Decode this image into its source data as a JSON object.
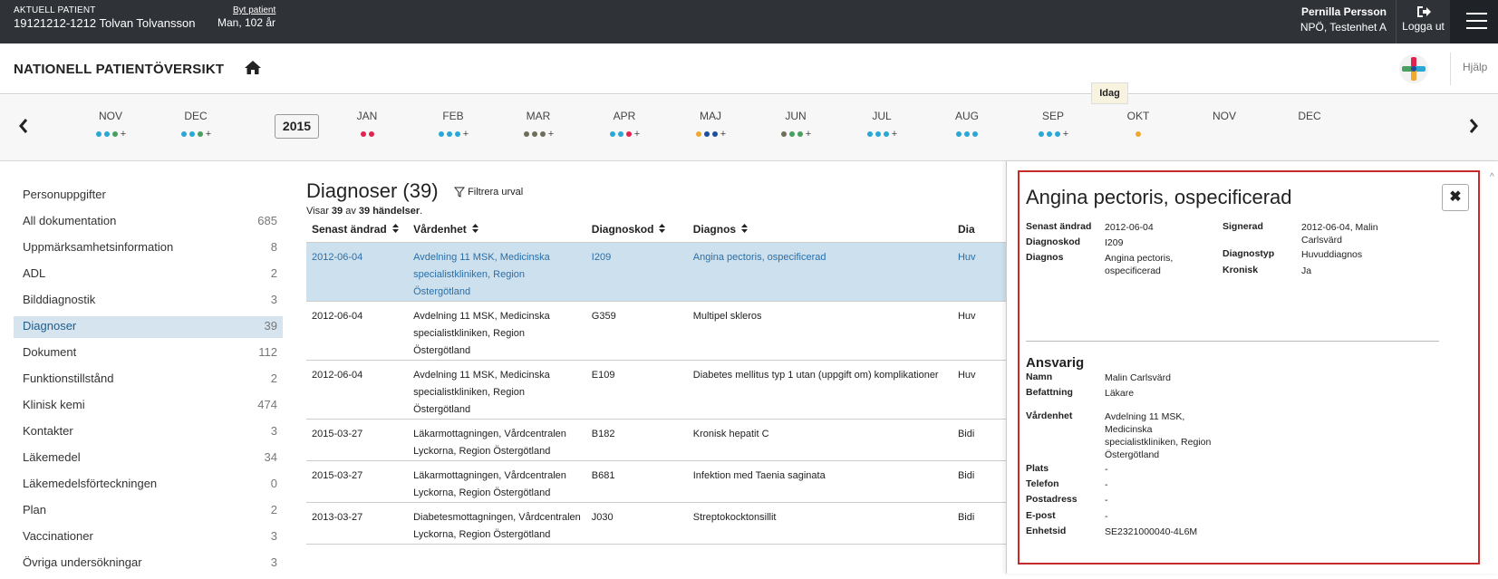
{
  "patient": {
    "label": "AKTUELL PATIENT",
    "id_name": "19121212-1212 Tolvan Tolvansson",
    "change_link": "Byt patient",
    "sex_age": "Man, 102 år"
  },
  "user": {
    "name": "Pernilla Persson",
    "unit": "NPÖ, Testenhet A",
    "logout": "Logga ut"
  },
  "header": {
    "title": "NATIONELL PATIENTÖVERSIKT",
    "help": "Hjälp"
  },
  "timeline": {
    "year": "2015",
    "today": "Idag",
    "months": [
      {
        "label": "NOV",
        "dots": [
          "#29a8d6",
          "#29a8d6",
          "#4a9f5e"
        ],
        "plus": "+"
      },
      {
        "label": "DEC",
        "dots": [
          "#29a8d6",
          "#29a8d6",
          "#4a9f5e"
        ],
        "plus": "+"
      },
      {
        "label": "JAN",
        "dots": [
          "#e0234f",
          "#e0234f"
        ],
        "plus": ""
      },
      {
        "label": "FEB",
        "dots": [
          "#29a8d6",
          "#29a8d6",
          "#29a8d6"
        ],
        "plus": "+"
      },
      {
        "label": "MAR",
        "dots": [
          "#6e6e5a",
          "#6e6e5a",
          "#6e6e5a"
        ],
        "plus": "+"
      },
      {
        "label": "APR",
        "dots": [
          "#29a8d6",
          "#29a8d6",
          "#e0234f"
        ],
        "plus": "+"
      },
      {
        "label": "MAJ",
        "dots": [
          "#f0a830",
          "#1d4f9e",
          "#1d4f9e"
        ],
        "plus": "+"
      },
      {
        "label": "JUN",
        "dots": [
          "#6e6e5a",
          "#4a9f5e",
          "#4a9f5e"
        ],
        "plus": "+"
      },
      {
        "label": "JUL",
        "dots": [
          "#29a8d6",
          "#29a8d6",
          "#29a8d6"
        ],
        "plus": "+"
      },
      {
        "label": "AUG",
        "dots": [
          "#29a8d6",
          "#29a8d6",
          "#29a8d6"
        ],
        "plus": ""
      },
      {
        "label": "SEP",
        "dots": [
          "#29a8d6",
          "#29a8d6",
          "#29a8d6"
        ],
        "plus": "+"
      },
      {
        "label": "OKT",
        "dots": [
          "#f0a830"
        ],
        "plus": ""
      },
      {
        "label": "NOV",
        "dots": [],
        "plus": ""
      },
      {
        "label": "DEC",
        "dots": [],
        "plus": ""
      }
    ]
  },
  "sidebar": {
    "items": [
      {
        "label": "Personuppgifter",
        "count": ""
      },
      {
        "label": "All dokumentation",
        "count": "685"
      },
      {
        "label": "Uppmärksamhetsinformation",
        "count": "8"
      },
      {
        "label": "ADL",
        "count": "2"
      },
      {
        "label": "Bilddiagnostik",
        "count": "3"
      },
      {
        "label": "Diagnoser",
        "count": "39",
        "active": true
      },
      {
        "label": "Dokument",
        "count": "112"
      },
      {
        "label": "Funktionstillstånd",
        "count": "2"
      },
      {
        "label": "Klinisk kemi",
        "count": "474"
      },
      {
        "label": "Kontakter",
        "count": "3"
      },
      {
        "label": "Läkemedel",
        "count": "34"
      },
      {
        "label": "Läkemedelsförteckningen",
        "count": "0"
      },
      {
        "label": "Plan",
        "count": "2"
      },
      {
        "label": "Vaccinationer",
        "count": "3"
      },
      {
        "label": "Övriga undersökningar",
        "count": "3"
      }
    ]
  },
  "main": {
    "title": "Diagnoser (39)",
    "filter": "Filtrera urval",
    "shows_prefix": "Visar ",
    "shows_a": "39",
    "shows_mid": " av ",
    "shows_b": "39 händelser",
    "shows_suffix": ".",
    "columns": [
      "Senast ändrad",
      "Vårdenhet",
      "Diagnoskod",
      "Diagnos",
      "Dia"
    ],
    "rows": [
      {
        "date": "2012-06-04",
        "unit": [
          "Avdelning 11 MSK, Medicinska",
          "specialistkliniken, Region",
          "Östergötland"
        ],
        "code": "I209",
        "diag": "Angina pectoris, ospecificerad",
        "type": "Huv",
        "selected": true
      },
      {
        "date": "2012-06-04",
        "unit": [
          "Avdelning 11 MSK, Medicinska",
          "specialistkliniken, Region",
          "Östergötland"
        ],
        "code": "G359",
        "diag": "Multipel skleros",
        "type": "Huv"
      },
      {
        "date": "2012-06-04",
        "unit": [
          "Avdelning 11 MSK, Medicinska",
          "specialistkliniken, Region",
          "Östergötland"
        ],
        "code": "E109",
        "diag": "Diabetes mellitus typ 1 utan (uppgift om) komplikationer",
        "type": "Huv"
      },
      {
        "date": "2015-03-27",
        "unit": [
          "Läkarmottagningen, Vårdcentralen",
          "Lyckorna, Region Östergötland"
        ],
        "code": "B182",
        "diag": "Kronisk hepatit C",
        "type": "Bidi"
      },
      {
        "date": "2015-03-27",
        "unit": [
          "Läkarmottagningen, Vårdcentralen",
          "Lyckorna, Region Östergötland"
        ],
        "code": "B681",
        "diag": "Infektion med Taenia saginata",
        "type": "Bidi"
      },
      {
        "date": "2013-03-27",
        "unit": [
          "Diabetesmottagningen, Vårdcentralen",
          "Lyckorna, Region Östergötland"
        ],
        "code": "J030",
        "diag": "Streptokocktonsillit",
        "type": "Bidi"
      }
    ]
  },
  "detail": {
    "title": "Angina pectoris, ospecificerad",
    "close": "✖",
    "left": [
      {
        "k": "Senast ändrad",
        "v": [
          "2012-06-04"
        ]
      },
      {
        "k": "Diagnoskod",
        "v": [
          "I209"
        ]
      },
      {
        "k": "Diagnos",
        "v": [
          "Angina pectoris,",
          "ospecificerad"
        ]
      }
    ],
    "right": [
      {
        "k": "Signerad",
        "v": [
          "2012-06-04, Malin",
          "Carlsvärd"
        ]
      },
      {
        "k": "Diagnostyp",
        "v": [
          "Huvuddiagnos"
        ]
      },
      {
        "k": "Kronisk",
        "v": [
          "Ja"
        ]
      }
    ],
    "responsible_title": "Ansvarig",
    "responsible": [
      {
        "k": "Namn",
        "v": [
          "Malin Carlsvärd"
        ]
      },
      {
        "k": "Befattning",
        "v": [
          "Läkare"
        ]
      },
      {
        "k": "Vårdenhet",
        "v": [
          "Avdelning 11 MSK,",
          "Medicinska",
          "specialistkliniken, Region",
          "Östergötland"
        ]
      },
      {
        "k": "Plats",
        "v": [
          "-"
        ]
      },
      {
        "k": "Telefon",
        "v": [
          "-"
        ]
      },
      {
        "k": "Postadress",
        "v": [
          "-"
        ]
      },
      {
        "k": "E-post",
        "v": [
          "-"
        ]
      },
      {
        "k": "Enhetsid",
        "v": [
          "SE2321000040-4L6M"
        ]
      }
    ]
  }
}
